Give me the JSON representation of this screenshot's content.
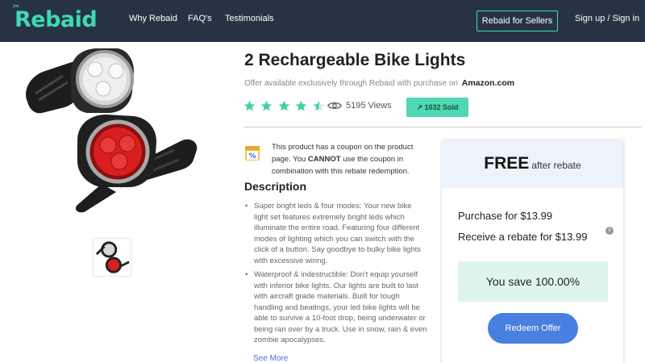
{
  "header": {
    "logo_text": "Rebaid",
    "nav": [
      "Why Rebaid",
      "FAQ's",
      "Testimonials"
    ],
    "sellers_button": "Rebaid for Sellers",
    "signin": "Sign up / Sign in",
    "colors": {
      "bar": "#273345",
      "accent": "#3fd9b4"
    }
  },
  "product": {
    "title": "2 Rechargeable Bike Lights",
    "offer_text": "Offer available exclusively through Rebaid with purchase on",
    "store": "Amazon.com",
    "rating": 4.5,
    "views": "5195 Views",
    "sold": "1032 Sold",
    "coupon_note": {
      "part1": "This product has a coupon on the product page. You ",
      "emphasis": "CANNOT",
      "part2": " use the coupon in combination with this rebate redemption."
    },
    "description_heading": "Description",
    "description": [
      "Super bright leds & four modes: Your new bike light set features extremely bright leds which illuminate the entire road. Featuring four different modes of lighting which you can switch with the click of a button. Say goodbye to bulky bike lights with excessive wiring.",
      "Waterproof & indestructible: Don't equip yourself with inferior bike lights. Our lights are built to last with aircraft grade materials. Built for tough handling and beatings, your led bike lights will be able to survive a 10-foot drop, being underwater or being ran over by a truck. Use in snow, rain & even zombie apocalypses."
    ],
    "see_more": "See More"
  },
  "rebate": {
    "free": "FREE",
    "after": "after rebate",
    "purchase": "Purchase for $13.99",
    "receive": "Receive a rebate for $13.99",
    "save": "You save 100.00%",
    "redeem": "Redeem Offer",
    "colors": {
      "button": "#4a7fe2",
      "save_bg": "#dff5ec",
      "head_bg": "#edf3fb"
    }
  }
}
